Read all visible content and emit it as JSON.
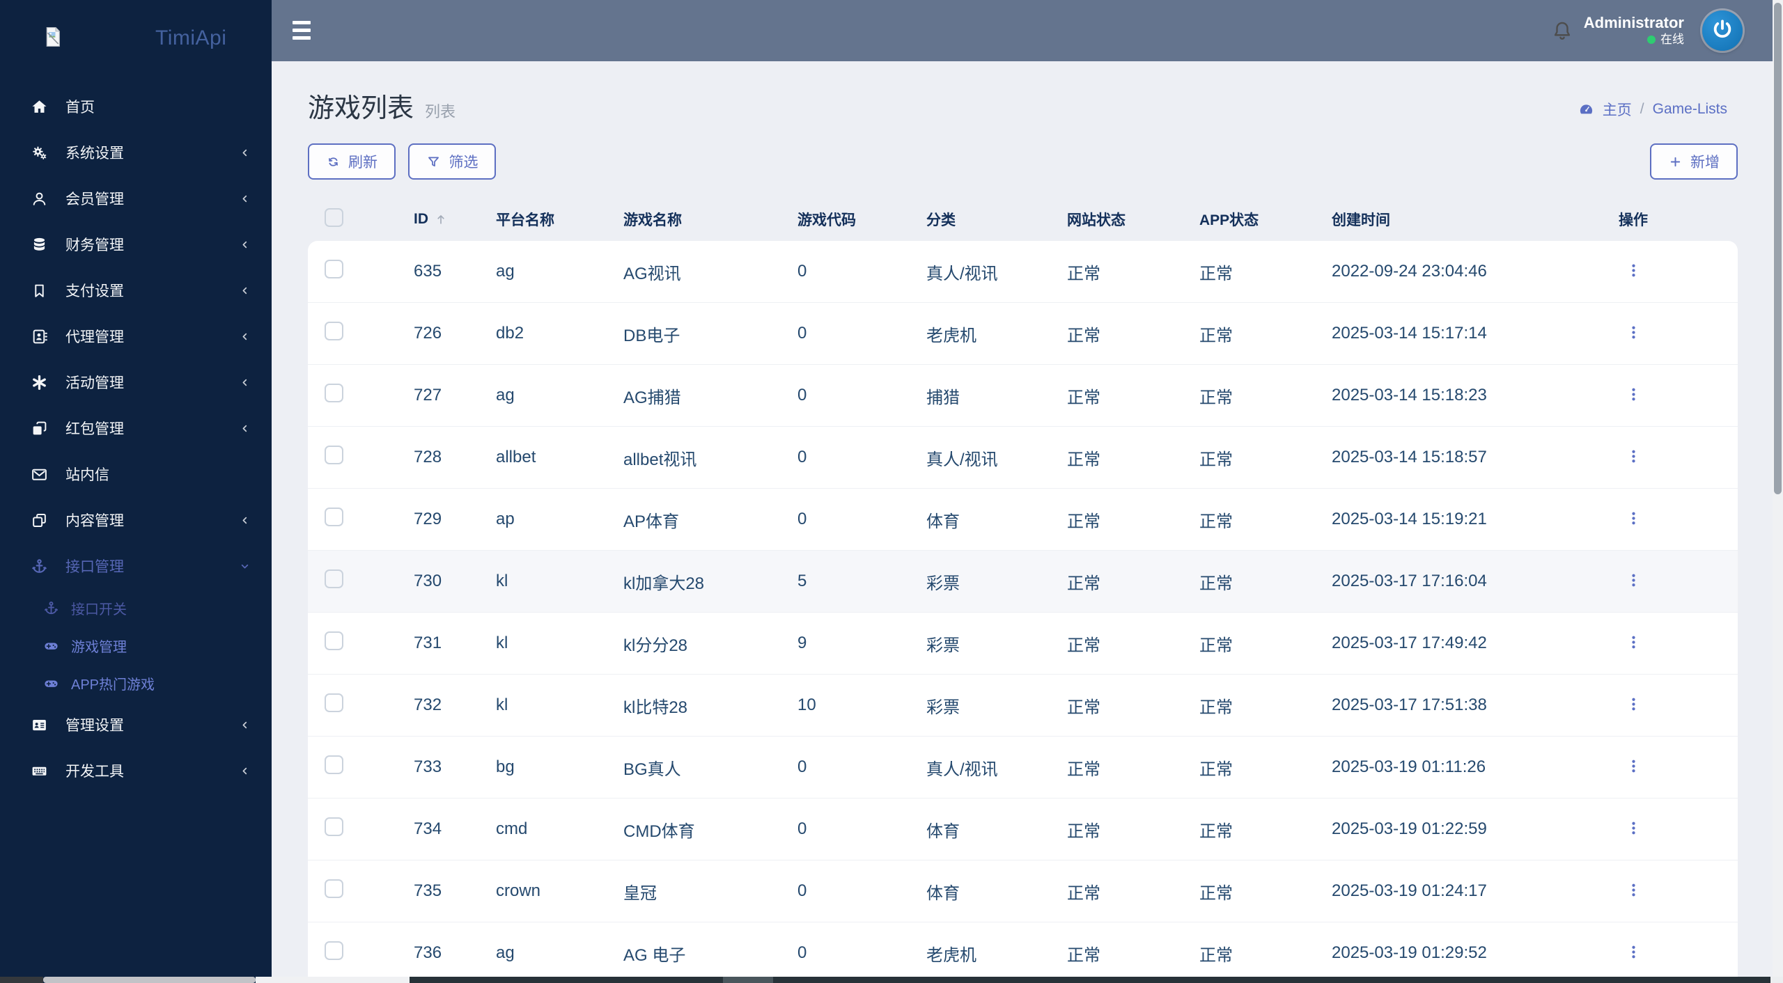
{
  "brand": {
    "name": "TimiApi"
  },
  "topbar": {
    "username": "Administrator",
    "status_label": "在线"
  },
  "sidebar": [
    {
      "key": "home",
      "label": "首页",
      "icon": "home-icon"
    },
    {
      "key": "system-settings",
      "label": "系统设置",
      "icon": "gears-icon",
      "arrow": "left"
    },
    {
      "key": "member-management",
      "label": "会员管理",
      "icon": "user-icon",
      "arrow": "left"
    },
    {
      "key": "finance-management",
      "label": "财务管理",
      "icon": "database-icon",
      "arrow": "left"
    },
    {
      "key": "payment-settings",
      "label": "支付设置",
      "icon": "bookmark-icon",
      "arrow": "left"
    },
    {
      "key": "agent-management",
      "label": "代理管理",
      "icon": "address-book-icon",
      "arrow": "left"
    },
    {
      "key": "activity-management",
      "label": "活动管理",
      "icon": "burst-icon",
      "arrow": "left"
    },
    {
      "key": "redpacket-management",
      "label": "红包管理",
      "icon": "clone-icon",
      "arrow": "left"
    },
    {
      "key": "site-messages",
      "label": "站内信",
      "icon": "envelope-icon"
    },
    {
      "key": "content-management",
      "label": "内容管理",
      "icon": "copy-icon",
      "arrow": "left"
    },
    {
      "key": "api-management",
      "label": "接口管理",
      "icon": "anchor-icon",
      "arrow": "down",
      "state": "expanded",
      "children": [
        {
          "key": "api-switch",
          "label": "接口开关",
          "icon": "anchor-icon",
          "state": "dim"
        },
        {
          "key": "game-management",
          "label": "游戏管理",
          "icon": "gamepad-icon",
          "state": "active"
        },
        {
          "key": "app-hot-games",
          "label": "APP热门游戏",
          "icon": "gamepad-icon",
          "state": "active"
        }
      ]
    },
    {
      "key": "admin-settings",
      "label": "管理设置",
      "icon": "id-card-icon",
      "arrow": "left"
    },
    {
      "key": "dev-tools",
      "label": "开发工具",
      "icon": "keyboard-icon",
      "arrow": "left"
    }
  ],
  "page": {
    "title": "游戏列表",
    "subtitle": "列表",
    "breadcrumb_home": "主页",
    "breadcrumb_sep": "/",
    "breadcrumb_current": "Game-Lists"
  },
  "toolbar": {
    "refresh": "刷新",
    "filter": "筛选",
    "add": "新增"
  },
  "table": {
    "columns": {
      "id": "ID",
      "platform": "平台名称",
      "name": "游戏名称",
      "code": "游戏代码",
      "category": "分类",
      "site_status": "网站状态",
      "app_status": "APP状态",
      "created": "创建时间",
      "actions": "操作"
    },
    "rows": [
      {
        "id": "635",
        "platform": "ag",
        "name": "AG视讯",
        "code": "0",
        "category": "真人/视讯",
        "site_status": "正常",
        "app_status": "正常",
        "created": "2022-09-24 23:04:46",
        "highlight": false
      },
      {
        "id": "726",
        "platform": "db2",
        "name": "DB电子",
        "code": "0",
        "category": "老虎机",
        "site_status": "正常",
        "app_status": "正常",
        "created": "2025-03-14 15:17:14",
        "highlight": false
      },
      {
        "id": "727",
        "platform": "ag",
        "name": "AG捕猎",
        "code": "0",
        "category": "捕猎",
        "site_status": "正常",
        "app_status": "正常",
        "created": "2025-03-14 15:18:23",
        "highlight": false
      },
      {
        "id": "728",
        "platform": "allbet",
        "name": "allbet视讯",
        "code": "0",
        "category": "真人/视讯",
        "site_status": "正常",
        "app_status": "正常",
        "created": "2025-03-14 15:18:57",
        "highlight": false
      },
      {
        "id": "729",
        "platform": "ap",
        "name": "AP体育",
        "code": "0",
        "category": "体育",
        "site_status": "正常",
        "app_status": "正常",
        "created": "2025-03-14 15:19:21",
        "highlight": false
      },
      {
        "id": "730",
        "platform": "kl",
        "name": "kl加拿大28",
        "code": "5",
        "category": "彩票",
        "site_status": "正常",
        "app_status": "正常",
        "created": "2025-03-17 17:16:04",
        "highlight": true
      },
      {
        "id": "731",
        "platform": "kl",
        "name": "kl分分28",
        "code": "9",
        "category": "彩票",
        "site_status": "正常",
        "app_status": "正常",
        "created": "2025-03-17 17:49:42",
        "highlight": false
      },
      {
        "id": "732",
        "platform": "kl",
        "name": "kl比特28",
        "code": "10",
        "category": "彩票",
        "site_status": "正常",
        "app_status": "正常",
        "created": "2025-03-17 17:51:38",
        "highlight": false
      },
      {
        "id": "733",
        "platform": "bg",
        "name": "BG真人",
        "code": "0",
        "category": "真人/视讯",
        "site_status": "正常",
        "app_status": "正常",
        "created": "2025-03-19 01:11:26",
        "highlight": false
      },
      {
        "id": "734",
        "platform": "cmd",
        "name": "CMD体育",
        "code": "0",
        "category": "体育",
        "site_status": "正常",
        "app_status": "正常",
        "created": "2025-03-19 01:22:59",
        "highlight": false
      },
      {
        "id": "735",
        "platform": "crown",
        "name": "皇冠",
        "code": "0",
        "category": "体育",
        "site_status": "正常",
        "app_status": "正常",
        "created": "2025-03-19 01:24:17",
        "highlight": false
      },
      {
        "id": "736",
        "platform": "ag",
        "name": "AG 电子",
        "code": "0",
        "category": "老虎机",
        "site_status": "正常",
        "app_status": "正常",
        "created": "2025-03-19 01:29:52",
        "highlight": false
      }
    ]
  },
  "colors": {
    "sidebar_bg": "#0d2240",
    "topbar_bg": "#64748e",
    "accent_indigo": "#5b6fc4",
    "content_bg": "#edeff4",
    "table_text": "#25496e",
    "online_green": "#2ecc71",
    "avatar_blue": "#1a80c9"
  }
}
